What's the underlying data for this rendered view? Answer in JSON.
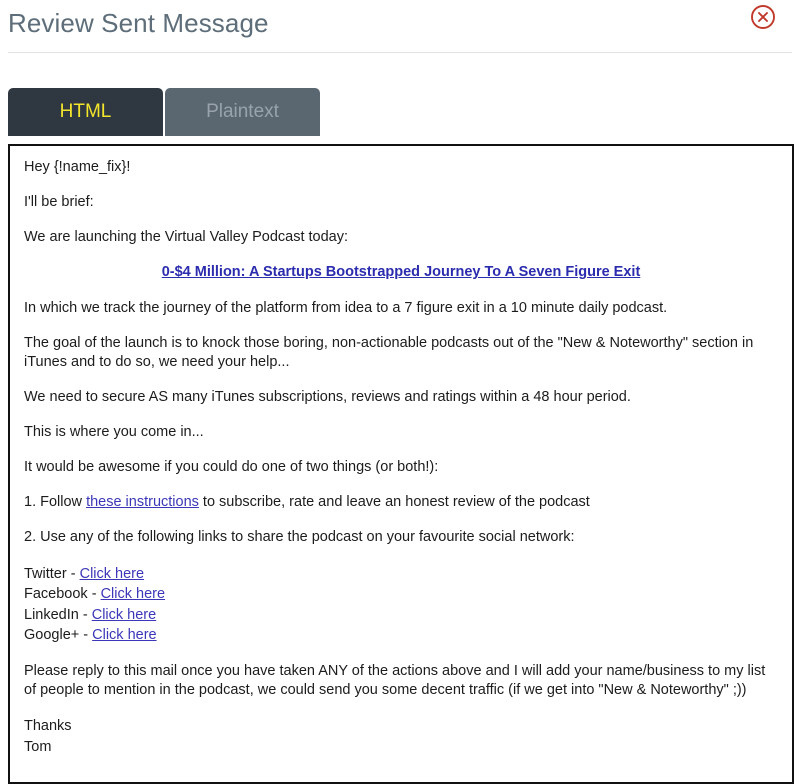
{
  "header": {
    "title": "Review Sent Message",
    "close_icon": "close-circle-icon"
  },
  "tabs": [
    {
      "label": "HTML",
      "active": true
    },
    {
      "label": "Plaintext",
      "active": false
    }
  ],
  "colors": {
    "title": "#5d6d79",
    "tab_active_bg": "#2f3840",
    "tab_active_text": "#f2e52c",
    "tab_inactive_bg": "#5a6771",
    "tab_inactive_text": "#98a3ab",
    "close_icon": "#c0392b",
    "link": "#3b37b8",
    "body_border": "#111111"
  },
  "message": {
    "greeting": "Hey {!name_fix}!",
    "line_brief": "I'll be brief:",
    "line_launch": "We are launching the Virtual Valley Podcast today:",
    "headline_link": "0-$4 Million: A Startups Bootstrapped Journey To A Seven Figure Exit",
    "para_track": "In which we track the journey of the platform from idea to a 7 figure exit in a 10 minute daily podcast.",
    "para_goal": "The goal of the launch is to knock those boring, non-actionable podcasts out of the \"New & Noteworthy\" section in iTunes and to do so, we need your help...",
    "para_secure": "We need to secure AS many iTunes subscriptions, reviews and ratings within a 48 hour period.",
    "para_come_in": "This is where you come in...",
    "para_awesome": "It would be awesome if you could do one of two things (or both!):",
    "item1_prefix": "1. Follow ",
    "item1_link": "these instructions",
    "item1_suffix": " to subscribe, rate and leave an honest review of the podcast",
    "item2": "2. Use any of the following links to share the podcast on your favourite social network:",
    "social_links": [
      {
        "network": "Twitter - ",
        "link_label": "Click here"
      },
      {
        "network": "Facebook - ",
        "link_label": "Click here"
      },
      {
        "network": "LinkedIn - ",
        "link_label": "Click here"
      },
      {
        "network": "Google+ - ",
        "link_label": "Click here"
      }
    ],
    "para_reply": "Please reply to this mail once you have taken ANY of the actions above and I will add your name/business to my list of people to mention in the podcast, we could send you some decent traffic (if we get into \"New & Noteworthy\" ;))",
    "sign_off": "Thanks",
    "sign_name": "Tom"
  }
}
